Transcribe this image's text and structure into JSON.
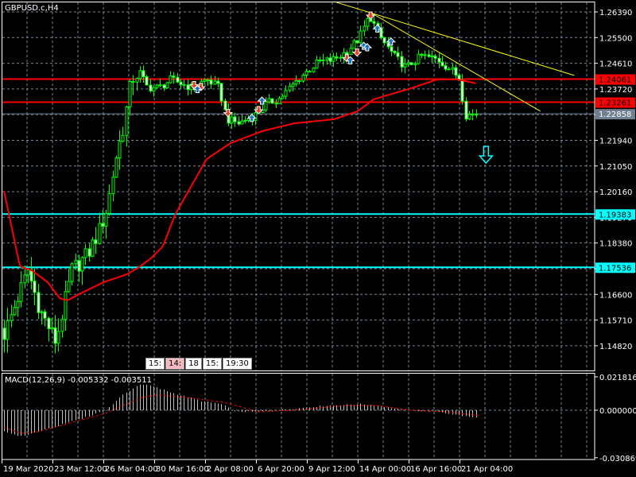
{
  "symbol_label": "GBPUSD.c,H4",
  "price_axis": [
    "1.26390",
    "1.25500",
    "1.24610",
    "1.23720",
    "1.22830",
    "1.21940",
    "1.21050",
    "1.20160",
    "1.19270",
    "1.18380",
    "1.17490",
    "1.16600",
    "1.15710",
    "1.14820"
  ],
  "price_tags": [
    {
      "value": "1.24061",
      "color": "#ff0000",
      "text_color": "#000000"
    },
    {
      "value": "1.23261",
      "color": "#ff0000",
      "text_color": "#000000"
    },
    {
      "value": "1.22858",
      "color": "#708090",
      "text_color": "#ffffff"
    },
    {
      "value": "1.19383",
      "color": "#00ffff",
      "text_color": "#000000"
    },
    {
      "value": "1.17536",
      "color": "#00ffff",
      "text_color": "#000000"
    }
  ],
  "time_axis": [
    "19 Mar 2020",
    "23 Mar 12:00",
    "26 Mar 04:00",
    "30 Mar 16:00",
    "2 Apr 08:00",
    "6 Apr 20:00",
    "9 Apr 12:00",
    "14 Apr 00:00",
    "16 Apr 16:00",
    "21 Apr 04:00"
  ],
  "session_tags": [
    {
      "text": "15:",
      "pink": false
    },
    {
      "text": "14:",
      "pink": true
    },
    {
      "text": "18",
      "pink": false
    },
    {
      "text": "15:",
      "pink": false
    },
    {
      "text": "19:30",
      "pink": false
    }
  ],
  "macd": {
    "label": "MACD(12,26,9) -0.005332 -0.003511",
    "axis": [
      "0.021816",
      "0.000000",
      "-0.030869"
    ]
  },
  "colors": {
    "candle": "#00ff00",
    "ma": "#ff0000",
    "trend": "#ffff00",
    "grid": "#778899",
    "signal": "#ff0000",
    "hist": "#c0c0c0",
    "arrow": "#00ffff"
  },
  "chart_data": {
    "type": "candlestick",
    "price_range": [
      1.1432,
      1.268
    ],
    "close_path": [
      [
        0,
        1.1523
      ],
      [
        3.5,
        1.1633
      ],
      [
        7,
        1.1744
      ],
      [
        10.5,
        1.1606
      ],
      [
        15.2,
        1.1495
      ],
      [
        20,
        1.1744
      ],
      [
        24.6,
        1.1799
      ],
      [
        28,
        1.1881
      ],
      [
        30.4,
        1.1964
      ],
      [
        32.8,
        1.2129
      ],
      [
        35.1,
        1.2239
      ],
      [
        37.5,
        1.2405
      ],
      [
        39.8,
        1.2432
      ],
      [
        42.2,
        1.2377
      ],
      [
        45.7,
        1.2377
      ],
      [
        49.2,
        1.2405
      ],
      [
        55,
        1.2377
      ],
      [
        59.7,
        1.2405
      ],
      [
        63.2,
        1.2377
      ],
      [
        65.6,
        1.2267
      ],
      [
        69.1,
        1.2253
      ],
      [
        73.8,
        1.2281
      ],
      [
        77.3,
        1.2322
      ],
      [
        80.8,
        1.2336
      ],
      [
        84.3,
        1.2377
      ],
      [
        87.8,
        1.2419
      ],
      [
        92.5,
        1.2465
      ],
      [
        97.2,
        1.2474
      ],
      [
        100.7,
        1.2501
      ],
      [
        104.2,
        1.2543
      ],
      [
        107.7,
        1.2625
      ],
      [
        111.2,
        1.2543
      ],
      [
        114.8,
        1.2487
      ],
      [
        118.3,
        1.2446
      ],
      [
        123,
        1.2487
      ],
      [
        127.6,
        1.2474
      ],
      [
        132.3,
        1.2432
      ],
      [
        134.2,
        1.2405
      ],
      [
        135.8,
        1.2281
      ],
      [
        139.3,
        1.2286
      ]
    ],
    "moving_average": [
      [
        0,
        1.2019
      ],
      [
        4.7,
        1.1757
      ],
      [
        8.2,
        1.1743
      ],
      [
        12.9,
        1.1702
      ],
      [
        16.4,
        1.1647
      ],
      [
        18.7,
        1.1639
      ],
      [
        22.2,
        1.1661
      ],
      [
        29.3,
        1.1702
      ],
      [
        36.3,
        1.173
      ],
      [
        39.8,
        1.1754
      ],
      [
        43.3,
        1.1785
      ],
      [
        46.8,
        1.1826
      ],
      [
        50.4,
        1.1936
      ],
      [
        59.7,
        1.2129
      ],
      [
        66.7,
        1.2184
      ],
      [
        76.1,
        1.2226
      ],
      [
        85.5,
        1.2253
      ],
      [
        97.2,
        1.2267
      ],
      [
        104.2,
        1.2295
      ],
      [
        108.9,
        1.2336
      ],
      [
        120.6,
        1.2377
      ],
      [
        127.6,
        1.2405
      ],
      [
        133.5,
        1.2405
      ],
      [
        139.3,
        1.2391
      ]
    ],
    "levels": [
      1.24061,
      1.23261,
      1.22858,
      1.19383,
      1.17536
    ],
    "trendlines": [
      [
        [
          97.2,
          1.2675
        ],
        [
          168,
          1.2419
        ]
      ],
      [
        [
          107.7,
          1.2639
        ],
        [
          158,
          1.2295
        ]
      ]
    ],
    "trade_arrows": [
      [
        56,
        1.2387,
        "sell"
      ],
      [
        58,
        1.238,
        "sell"
      ],
      [
        57,
        1.237,
        "buy"
      ],
      [
        66,
        1.229,
        "sell"
      ],
      [
        73,
        1.227,
        "buy"
      ],
      [
        75,
        1.23,
        "sell"
      ],
      [
        76,
        1.233,
        "buy"
      ],
      [
        101,
        1.248,
        "sell"
      ],
      [
        102,
        1.247,
        "buy"
      ],
      [
        104,
        1.25,
        "sell"
      ],
      [
        106,
        1.252,
        "buy"
      ],
      [
        107,
        1.2515,
        "buy"
      ],
      [
        108,
        1.2628,
        "sell"
      ],
      [
        110,
        1.258,
        "buy"
      ],
      [
        114,
        1.2535,
        "buy"
      ]
    ],
    "signal_arrow": [
      142,
      1.214,
      "down"
    ],
    "macd_hist": [
      [
        0,
        -0.014
      ],
      [
        5,
        -0.017
      ],
      [
        10,
        -0.014
      ],
      [
        15,
        -0.011
      ],
      [
        20,
        -0.007
      ],
      [
        25,
        -0.004
      ],
      [
        30,
        0.0
      ],
      [
        35,
        0.01
      ],
      [
        40,
        0.017
      ],
      [
        43,
        0.016
      ],
      [
        50,
        0.011
      ],
      [
        58,
        0.006
      ],
      [
        64,
        0.004
      ],
      [
        68,
        -0.001
      ],
      [
        75,
        -0.001
      ],
      [
        85,
        0.001
      ],
      [
        95,
        0.003
      ],
      [
        105,
        0.004
      ],
      [
        110,
        0.003
      ],
      [
        118,
        0.0
      ],
      [
        128,
        -0.001
      ],
      [
        133,
        -0.003
      ],
      [
        140,
        -0.0053
      ]
    ],
    "macd_signal": [
      [
        0,
        -0.011
      ],
      [
        5,
        -0.015
      ],
      [
        10,
        -0.014
      ],
      [
        15,
        -0.011
      ],
      [
        20,
        -0.008
      ],
      [
        30,
        -0.002
      ],
      [
        40,
        0.008
      ],
      [
        45,
        0.01
      ],
      [
        55,
        0.008
      ],
      [
        65,
        0.005
      ],
      [
        75,
        -0.001
      ],
      [
        85,
        0.0
      ],
      [
        100,
        0.003
      ],
      [
        110,
        0.003
      ],
      [
        120,
        0.0
      ],
      [
        130,
        -0.001
      ],
      [
        140,
        -0.0035
      ]
    ],
    "macd_range": [
      -0.030869,
      0.021816
    ]
  }
}
